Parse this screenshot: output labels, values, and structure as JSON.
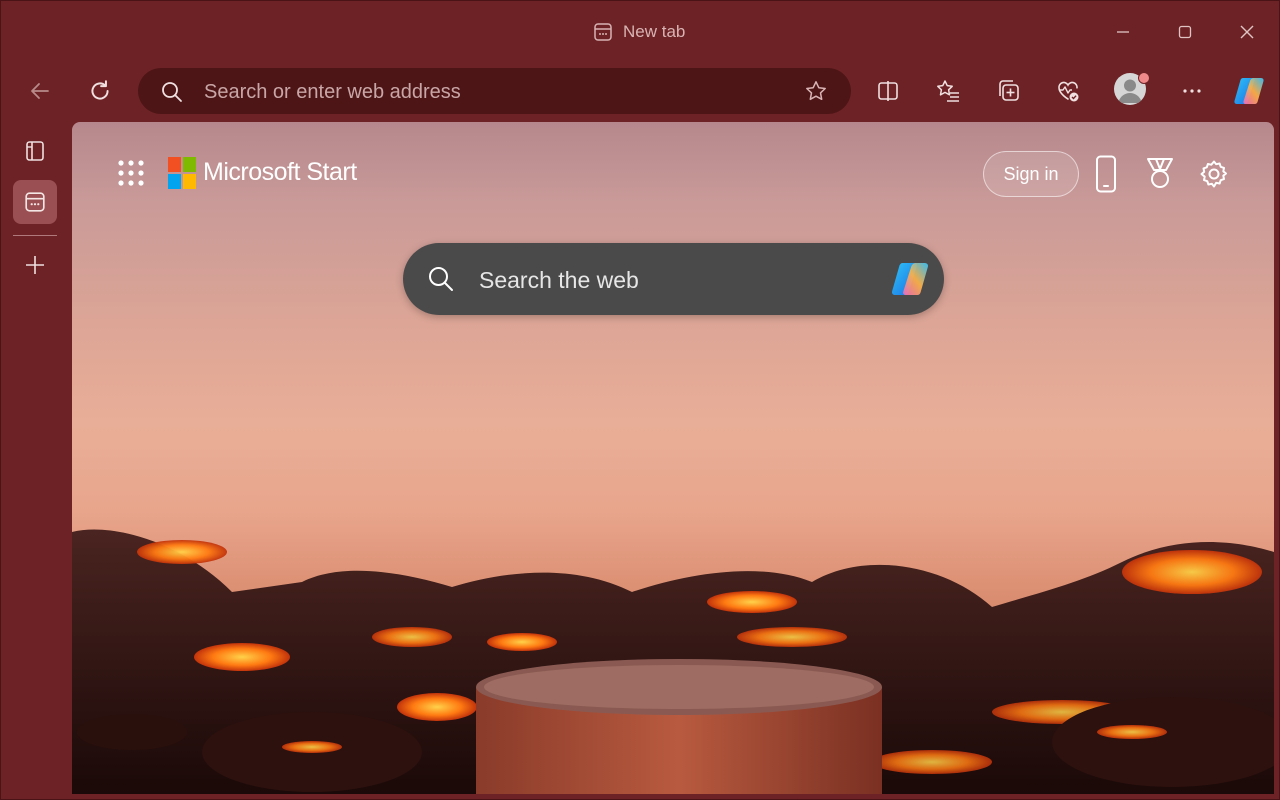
{
  "window": {
    "tab_title": "New tab",
    "icons": {
      "tab": "tab-page-icon",
      "minimize": "minimize-icon",
      "maximize": "maximize-icon",
      "close": "close-icon"
    }
  },
  "toolbar": {
    "address_placeholder": "Search or enter web address",
    "icons": [
      "back-arrow-icon",
      "refresh-icon",
      "search-icon",
      "star-icon",
      "split-screen-icon",
      "favorites-icon",
      "collections-icon",
      "browser-essentials-icon",
      "profile-icon",
      "more-icon",
      "copilot-icon"
    ]
  },
  "sidebar": {
    "icons": [
      "tab-actions-icon",
      "new-tab-page-icon",
      "add-tab-icon"
    ]
  },
  "start_page": {
    "brand": "Microsoft Start",
    "sign_in_label": "Sign in",
    "search_placeholder": "Search the web",
    "icons": [
      "app-launcher-icon",
      "microsoft-logo-icon",
      "phone-icon",
      "rewards-icon",
      "settings-icon",
      "copilot-icon"
    ]
  },
  "colors": {
    "frame": "#6d2326",
    "address_bar": "#4e1517",
    "search_box": "#4a4a4a",
    "active_tab": "#9a4f52"
  }
}
